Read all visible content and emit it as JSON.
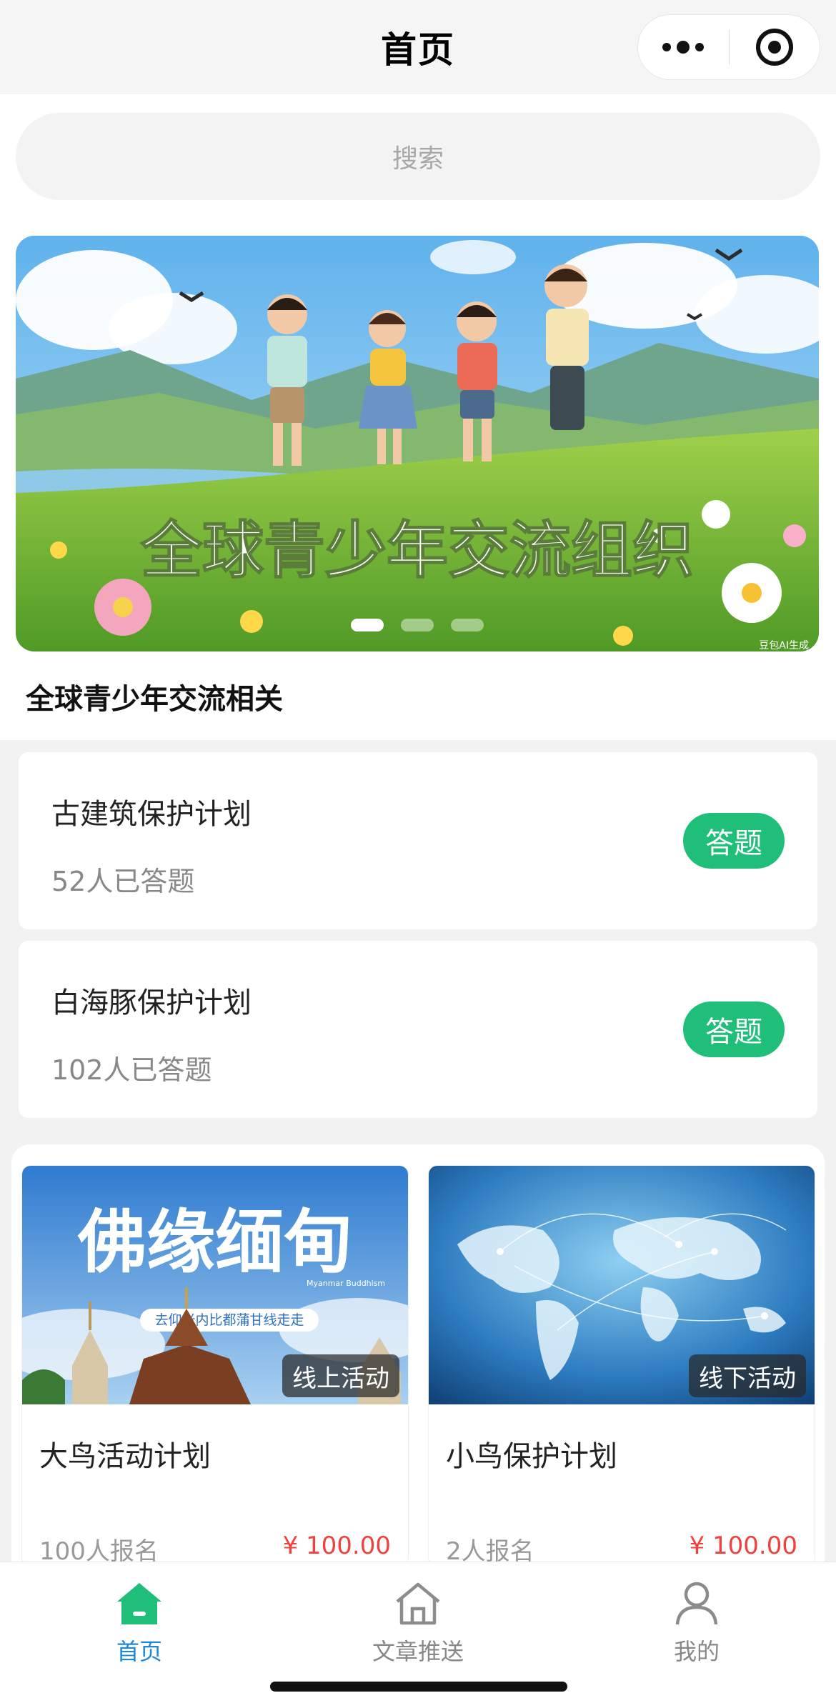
{
  "navbar": {
    "title": "首页"
  },
  "search": {
    "placeholder": "搜索"
  },
  "banner": {
    "caption": "全球青少年交流组织",
    "watermark": "豆包AI生成",
    "dots": 3,
    "active_dot": 0
  },
  "section": {
    "title": "全球青少年交流相关"
  },
  "quizzes": [
    {
      "title": "古建筑保护计划",
      "count": "52人已答题",
      "button": "答题"
    },
    {
      "title": "白海豚保护计划",
      "count": "102人已答题",
      "button": "答题"
    }
  ],
  "activities": [
    {
      "title": "大鸟活动计划",
      "tag": "线上活动",
      "count": "100人报名",
      "price": "¥ 100.00",
      "poster_title": "佛缘缅甸",
      "poster_subtitle": "去仰光内比都蒲甘线走走",
      "poster_brand": "Myanmar Buddhism"
    },
    {
      "title": "小鸟保护计划",
      "tag": "线下活动",
      "count": "2人报名",
      "price": "¥ 100.00"
    }
  ],
  "tabbar": {
    "items": [
      {
        "label": "首页",
        "icon": "home-icon",
        "active": true
      },
      {
        "label": "文章推送",
        "icon": "house-outline-icon",
        "active": false
      },
      {
        "label": "我的",
        "icon": "user-icon",
        "active": false
      }
    ]
  },
  "colors": {
    "accent_green": "#1fbf7a",
    "tab_active": "#1e88d8",
    "price_red": "#f0413f"
  }
}
